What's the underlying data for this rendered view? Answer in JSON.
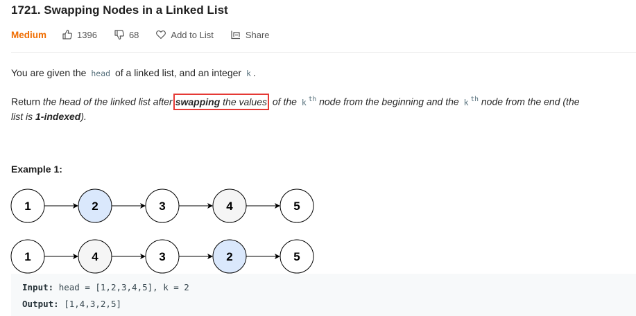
{
  "problem": {
    "title": "1721. Swapping Nodes in a Linked List",
    "difficulty": "Medium",
    "likes": "1396",
    "dislikes": "68",
    "add_to_list": "Add to List",
    "share": "Share"
  },
  "colors": {
    "difficulty": "#ef6c00",
    "highlight_box": "#e53935",
    "node_blue": "#dae8fc",
    "node_gray": "#f5f5f5"
  },
  "icons": [
    "thumbs-up-icon",
    "thumbs-down-icon",
    "heart-icon",
    "share-icon",
    "arrow-icon"
  ],
  "description": {
    "p1_before": "You are given the",
    "p1_code1": "head",
    "p1_mid": "of a linked list, and an integer",
    "p1_code2": "k",
    "p1_end": ".",
    "p2_a": "Return ",
    "p2_b": "the head of the linked list after",
    "p2_c": "swapping",
    "p2_d": " the values",
    "p2_e": " of the ",
    "p2_k": "k",
    "p2_th": "th",
    "p2_f": " node from the beginning and the ",
    "p2_g": " node from the end (the",
    "p3_a": "list is ",
    "p3_b": "1-indexed",
    "p3_c": ")."
  },
  "example": {
    "label": "Example 1:",
    "before_nodes": [
      {
        "label": "1",
        "fill": "#ffffff"
      },
      {
        "label": "2",
        "fill": "#dae8fc"
      },
      {
        "label": "3",
        "fill": "#ffffff"
      },
      {
        "label": "4",
        "fill": "#f5f5f5"
      },
      {
        "label": "5",
        "fill": "#ffffff"
      }
    ],
    "after_nodes": [
      {
        "label": "1",
        "fill": "#ffffff"
      },
      {
        "label": "4",
        "fill": "#f5f5f5"
      },
      {
        "label": "3",
        "fill": "#ffffff"
      },
      {
        "label": "2",
        "fill": "#dae8fc"
      },
      {
        "label": "5",
        "fill": "#ffffff"
      }
    ],
    "input_label": "Input:",
    "input_value": "head = [1,2,3,4,5], k = 2",
    "output_label": "Output:",
    "output_value": "[1,4,3,2,5]"
  }
}
